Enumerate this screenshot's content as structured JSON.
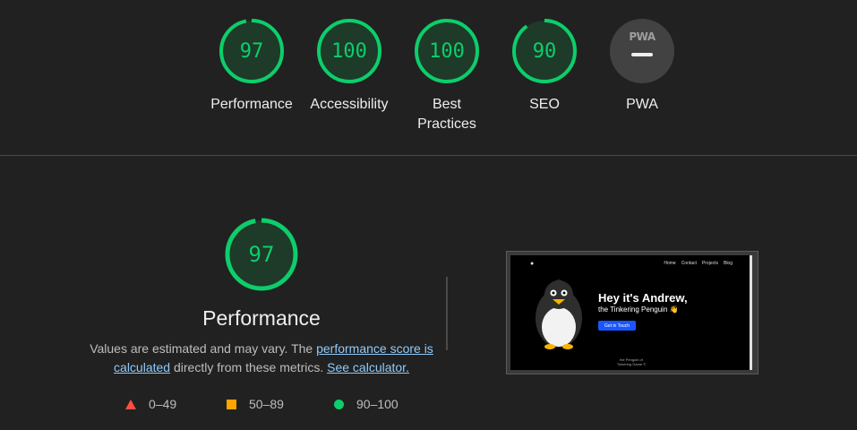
{
  "category_gauges": [
    {
      "id": "performance",
      "score": "97",
      "label": "Performance",
      "fraction": 0.97
    },
    {
      "id": "accessibility",
      "score": "100",
      "label": "Accessibility",
      "fraction": 1.0
    },
    {
      "id": "best-practices",
      "score": "100",
      "label_line1": "Best",
      "label_line2": "Practices",
      "fraction": 1.0
    },
    {
      "id": "seo",
      "score": "90",
      "label": "SEO",
      "fraction": 0.9
    },
    {
      "id": "pwa",
      "logo_text": "PWA",
      "label": "PWA"
    }
  ],
  "colors": {
    "pass": "#0cce6b",
    "average": "#ffa400",
    "fail": "#ff4e42",
    "background": "#212121",
    "link": "#90caf9"
  },
  "performance_section": {
    "score": "97",
    "fraction": 0.97,
    "title": "Performance",
    "desc_prefix": "Values are estimated and may vary. The ",
    "link_score_text": "performance score is calculated",
    "desc_middle": " directly from these metrics. ",
    "link_calculator_text": "See calculator."
  },
  "legend": [
    {
      "range": "0–49",
      "shape": "triangle"
    },
    {
      "range": "50–89",
      "shape": "square"
    },
    {
      "range": "90–100",
      "shape": "circle"
    }
  ],
  "screenshot_preview": {
    "nav": [
      "Home",
      "Contact",
      "Projects",
      "Blog"
    ],
    "hero_title": "Hey it's Andrew,",
    "hero_subtitle": "the Tinkering Penguin 👋",
    "hero_button": "Get in Touch",
    "footer_line1": "the Penguin of",
    "footer_line2": "Tinkering Game ©"
  }
}
